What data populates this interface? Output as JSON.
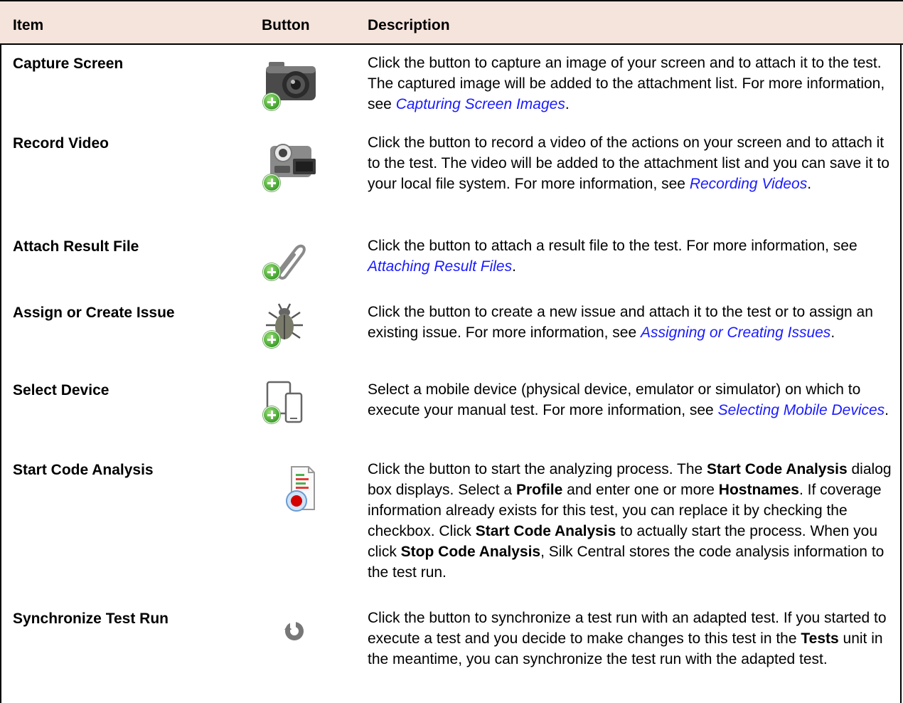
{
  "header": {
    "item": "Item",
    "button": "Button",
    "description": "Description"
  },
  "rows": [
    {
      "item": "Capture Screen",
      "icon": "camera-add-icon",
      "desc": {
        "text": "Click the button to capture an image of your screen and to attach it to the test. The captured image will be added to the attachment list. For more information, see ",
        "link": "Capturing Screen Images",
        "end": "."
      }
    },
    {
      "item": "Record Video",
      "icon": "video-camera-add-icon",
      "desc": {
        "text": "Click the button to record a video of the actions on your screen and to attach it to the test. The video will be added to the attachment list and you can save it to your local file system. For more information, see ",
        "link": "Recording Videos",
        "end": "."
      }
    },
    {
      "item": "Attach Result File",
      "icon": "paperclip-add-icon",
      "desc": {
        "text": "Click the button to attach a result file to the test. For more information, see ",
        "link": "Attaching Result Files",
        "end": "."
      }
    },
    {
      "item": "Assign or Create Issue",
      "icon": "bug-add-icon",
      "desc": {
        "text": "Click the button to create a new issue and attach it to the test or to assign an existing issue. For more information, see ",
        "link": "Assigning or Creating Issues",
        "end": "."
      }
    },
    {
      "item": "Select Device",
      "icon": "mobile-device-icon",
      "desc": {
        "text": "Select a mobile device (physical device, emulator or simulator) on which to execute your manual test. For more information, see ",
        "link": "Selecting Mobile Devices",
        "end": "."
      }
    },
    {
      "item": "Start Code Analysis",
      "icon": "code-analysis-record-icon",
      "desc5": {
        "p1": "Click the button to start the analyzing process. The ",
        "b1": "Start Code Analysis",
        "p2": " dialog box displays. Select a ",
        "b2": "Profile",
        "p3": " and enter one or more ",
        "b3": "Hostnames",
        "p4": ". If coverage information already exists for this test, you can replace it by checking the checkbox. Click ",
        "b4": "Start Code Analysis",
        "p5": " to actually start the process. When you click ",
        "b5": "Stop Code Analysis",
        "p6": ", Silk Central stores the code analysis information to the test run."
      }
    },
    {
      "item": "Synchronize Test Run",
      "icon": "synchronize-icon",
      "desc6": {
        "p1": "Click the button to synchronize a test run with an adapted test. If you started to execute a test and you decide to make changes to this test in the ",
        "b1": "Tests",
        "p2": " unit in the meantime, you can synchronize the test run with the adapted test."
      }
    }
  ]
}
